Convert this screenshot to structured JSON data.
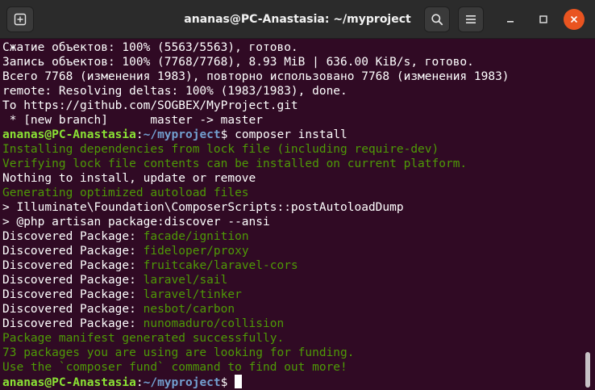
{
  "window": {
    "title": "ananas@PC-Anastasia: ~/myproject"
  },
  "titlebar": {
    "new_tab_icon": "new-tab-icon",
    "search_icon": "search-icon",
    "menu_icon": "hamburger-menu-icon",
    "minimize_icon": "minimize-icon",
    "maximize_icon": "maximize-icon",
    "close_icon": "close-icon"
  },
  "colors": {
    "background": "#300a24",
    "titlebar": "#2b2b2b",
    "text": "#ffffff",
    "green_output": "#4e9a06",
    "prompt_user": "#8ae234",
    "prompt_path": "#729fcf",
    "close_button": "#e95420"
  },
  "terminal": {
    "prompt_user": "ananas@PC-Anastasia",
    "prompt_path": "~/myproject",
    "prompt_symbol": "$",
    "lines": [
      "Сжатие объектов: 100% (5563/5563), готово.",
      "Запись объектов: 100% (7768/7768), 8.93 MiB | 636.00 KiB/s, готово.",
      "Всего 7768 (изменения 1983), повторно использовано 7768 (изменения 1983)",
      "remote: Resolving deltas: 100% (1983/1983), done.",
      "To https://github.com/SOGBEX/MyProject.git",
      " * [new branch]      master -> master"
    ],
    "command": " composer install",
    "output": [
      "Installing dependencies from lock file (including require-dev)",
      "Verifying lock file contents can be installed on current platform.",
      "Nothing to install, update or remove",
      "Generating optimized autoload files",
      "> Illuminate\\Foundation\\ComposerScripts::postAutoloadDump",
      "> @php artisan package:discover --ansi"
    ],
    "discovered_label": "Discovered Package: ",
    "packages": [
      "facade/ignition",
      "fideloper/proxy",
      "fruitcake/laravel-cors",
      "laravel/sail",
      "laravel/tinker",
      "nesbot/carbon",
      "nunomaduro/collision"
    ],
    "footer": [
      "Package manifest generated successfully.",
      "73 packages you are using are looking for funding.",
      "Use the `composer fund` command to find out more!"
    ]
  }
}
